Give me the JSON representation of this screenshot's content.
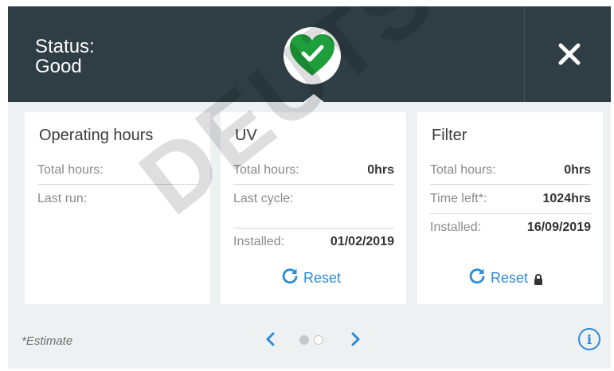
{
  "header": {
    "status_label": "Status:",
    "status_value": "Good",
    "status_icon": "heart-check-icon",
    "status_color": "#1f9e3c",
    "close_icon": "close-icon"
  },
  "cards": {
    "operating": {
      "title": "Operating hours",
      "total_hours_label": "Total hours:",
      "total_hours_value": "",
      "last_run_label": "Last run:",
      "last_run_value": ""
    },
    "uv": {
      "title": "UV",
      "total_hours_label": "Total hours:",
      "total_hours_value": "0hrs",
      "last_cycle_label": "Last cycle:",
      "last_cycle_value": "",
      "installed_label": "Installed:",
      "installed_value": "01/02/2019",
      "reset_label": "Reset",
      "reset_icon": "refresh-icon"
    },
    "filter": {
      "title": "Filter",
      "total_hours_label": "Total hours:",
      "total_hours_value": "0hrs",
      "time_left_label": "Time left*:",
      "time_left_value": "1024hrs",
      "installed_label": "Installed:",
      "installed_value": "16/09/2019",
      "reset_label": "Reset",
      "reset_icon": "refresh-icon",
      "lock_icon": "lock-icon"
    }
  },
  "footer": {
    "estimate_note": "*Estimate",
    "pagination": {
      "current_page": 1,
      "total_pages": 2
    },
    "accent_color": "#2c8bd6",
    "info_glyph": "i"
  },
  "watermark": "DEUTSCHER"
}
